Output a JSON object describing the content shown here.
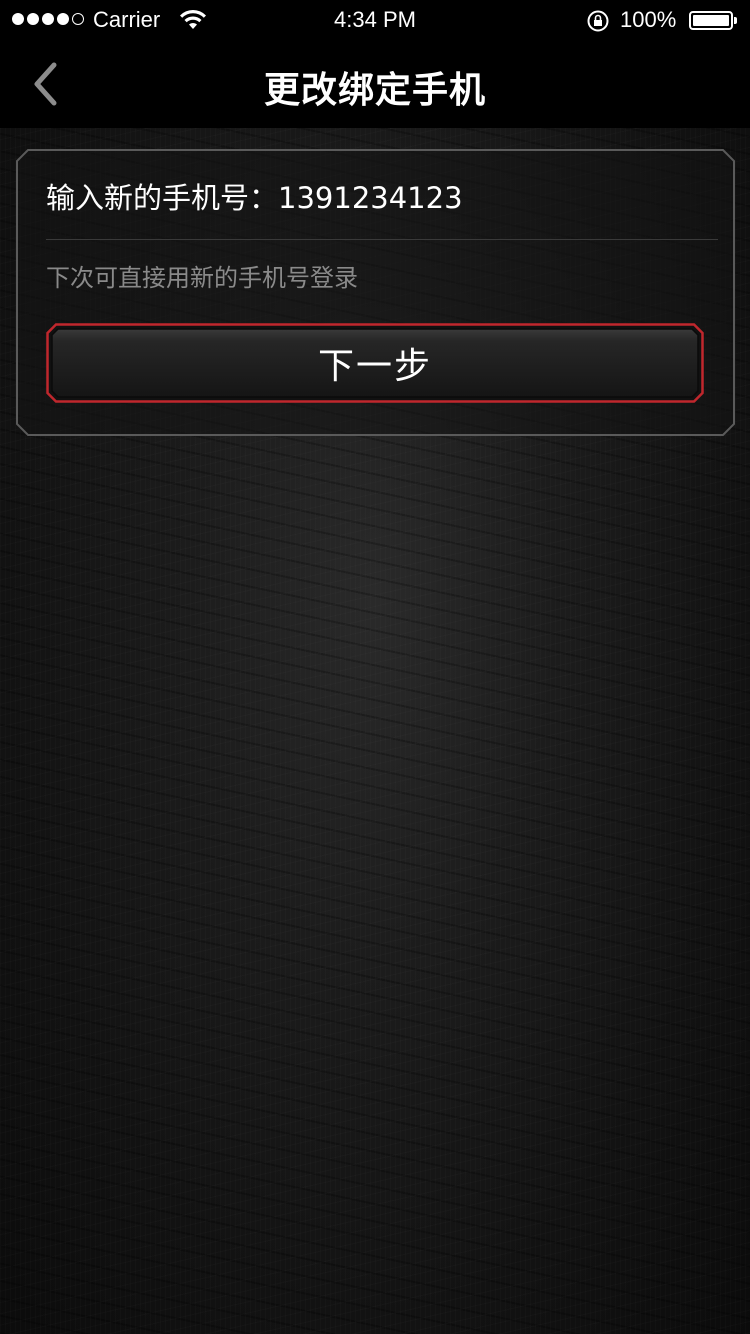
{
  "status_bar": {
    "carrier": "Carrier",
    "time": "4:34 PM",
    "battery_percent": "100%",
    "signal_bars_filled": 4,
    "signal_bars_total": 5
  },
  "nav": {
    "title": "更改绑定手机",
    "back_icon": "chevron-left-icon"
  },
  "form": {
    "phone_label": "输入新的手机号：",
    "phone_value": "1391234123",
    "hint": "下次可直接用新的手机号登录",
    "next_button_label": "下一步"
  },
  "colors": {
    "accent_red": "#c0272d",
    "background": "#1a1a1a",
    "hint_text": "#8a8a8a"
  }
}
